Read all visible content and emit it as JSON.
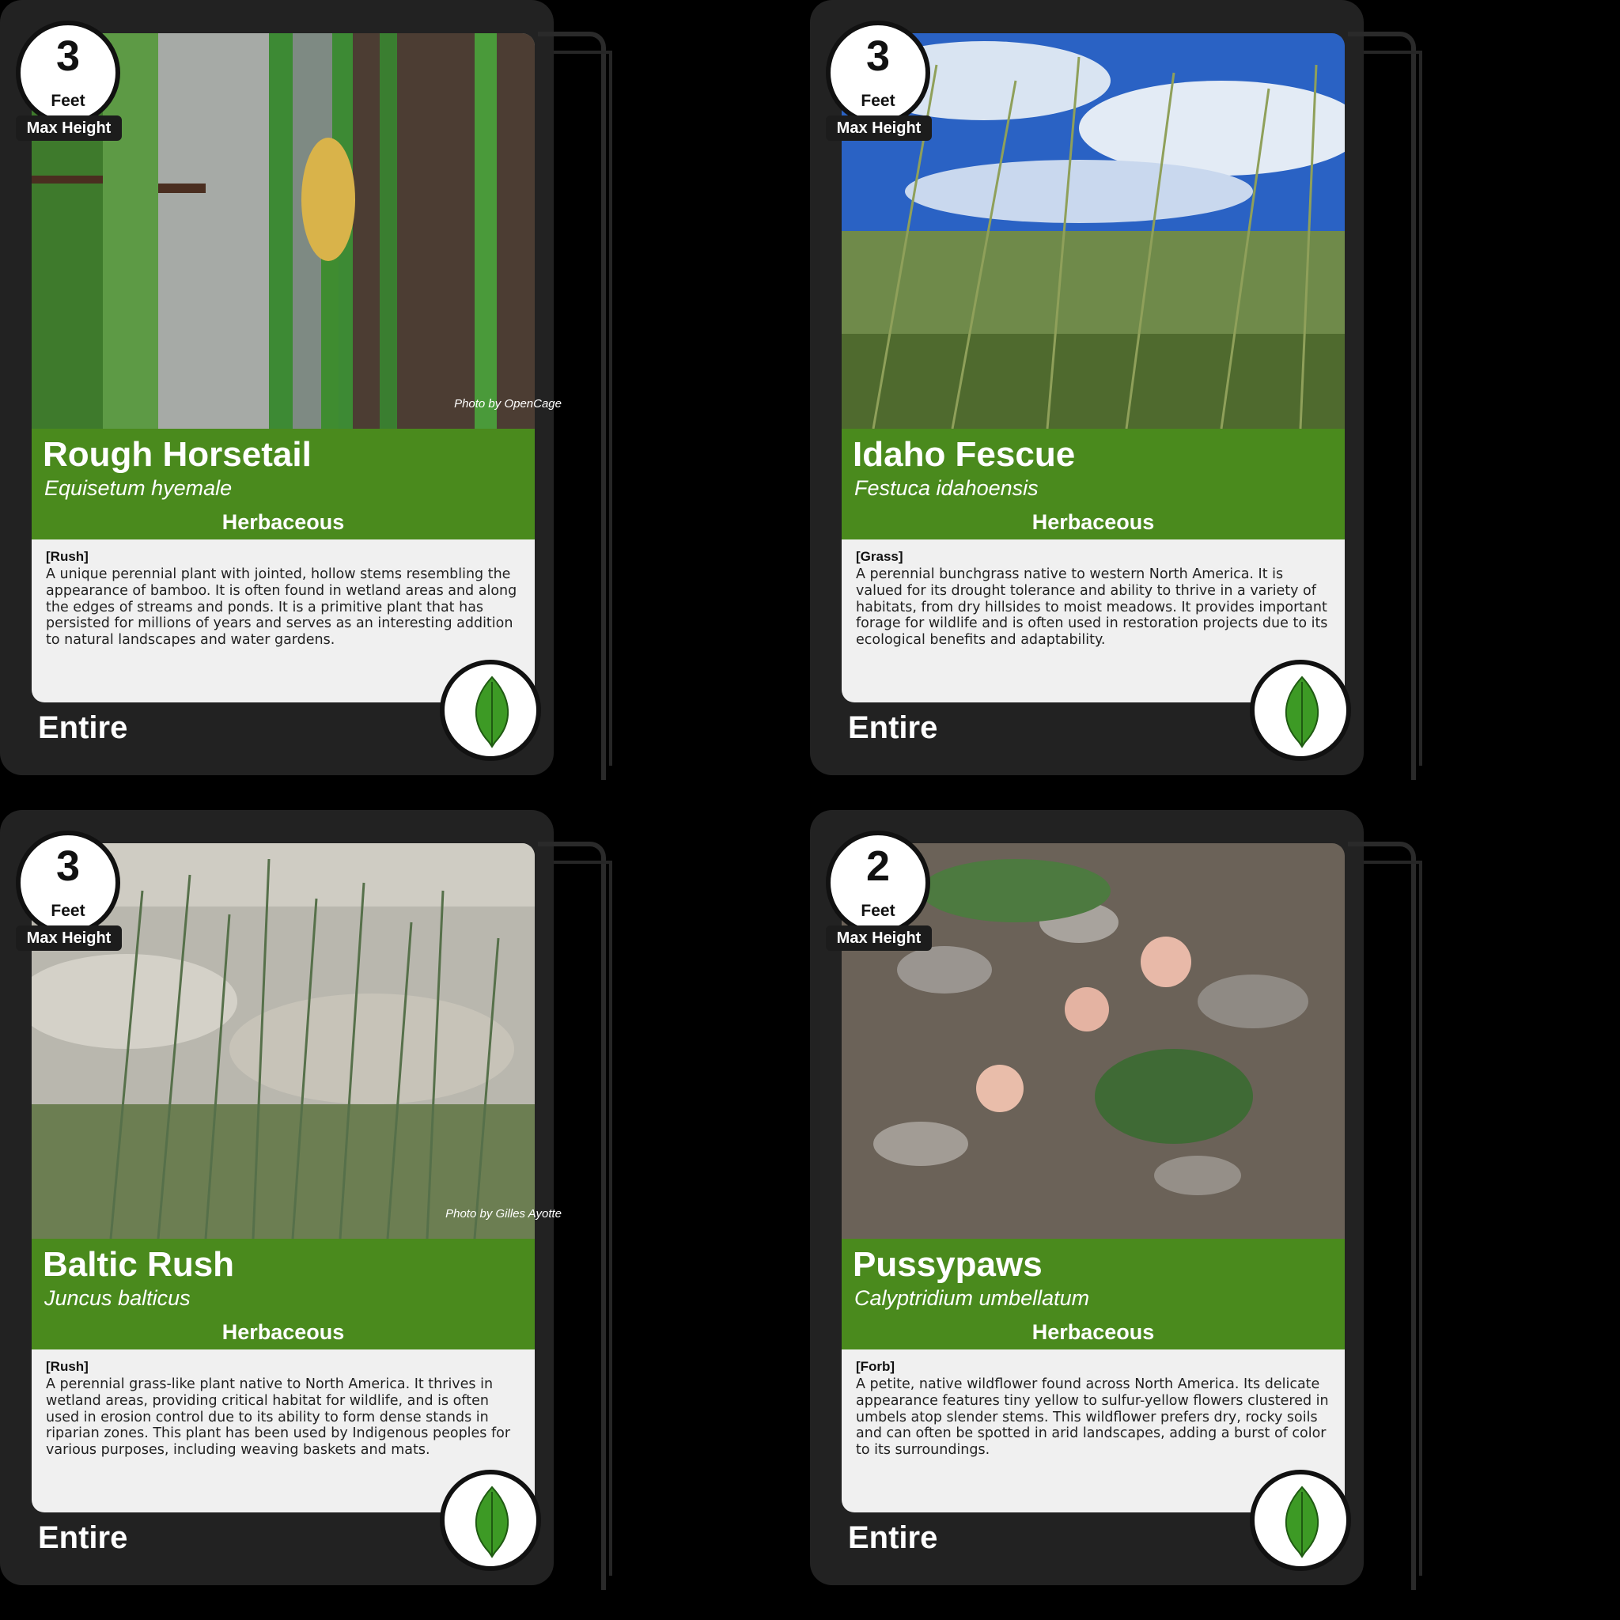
{
  "colors": {
    "accent_green": "#4a8a1d",
    "card_bg": "#222222",
    "desc_bg": "#f0f0f0"
  },
  "cards": [
    {
      "height_value": "3",
      "height_unit": "Feet",
      "height_label": "Max Height",
      "photo_credit": "Photo by OpenCage",
      "common_name": "Rough Horsetail",
      "scientific_name": "Equisetum hyemale",
      "habit": "Herbaceous",
      "category": "[Rush]",
      "description": "A unique perennial plant with jointed, hollow stems resembling the appearance of bamboo. It is often found in wetland areas and along the edges of streams and ponds. It is a primitive plant that has persisted for millions of years and serves as an interesting addition to natural landscapes and water gardens.",
      "leaf_margin": "Entire",
      "leaf_icon": "leaf-icon"
    },
    {
      "height_value": "3",
      "height_unit": "Feet",
      "height_label": "Max Height",
      "photo_credit": "",
      "common_name": "Idaho Fescue",
      "scientific_name": "Festuca idahoensis",
      "habit": "Herbaceous",
      "category": "[Grass]",
      "description": "A perennial bunchgrass native to western North America. It is valued for its drought tolerance and ability to thrive in a variety of habitats, from dry hillsides to moist meadows. It provides important forage for wildlife and is often used in restoration projects due to its ecological benefits and adaptability.",
      "leaf_margin": "Entire",
      "leaf_icon": "leaf-icon"
    },
    {
      "height_value": "3",
      "height_unit": "Feet",
      "height_label": "Max Height",
      "photo_credit": "Photo by Gilles Ayotte",
      "common_name": "Baltic Rush",
      "scientific_name": "Juncus balticus",
      "habit": "Herbaceous",
      "category": "[Rush]",
      "description": "A perennial grass-like plant native to North America. It thrives in wetland areas, providing critical habitat for wildlife, and is often used in erosion control due to its ability to form dense stands in riparian zones. This plant has been used by Indigenous peoples for various purposes, including weaving baskets and mats.",
      "leaf_margin": "Entire",
      "leaf_icon": "leaf-icon"
    },
    {
      "height_value": "2",
      "height_unit": "Feet",
      "height_label": "Max Height",
      "photo_credit": "",
      "common_name": "Pussypaws",
      "scientific_name": "Calyptridium umbellatum",
      "habit": "Herbaceous",
      "category": "[Forb]",
      "description": "A petite, native wildflower found across North America. Its delicate appearance features tiny yellow to sulfur-yellow flowers clustered in umbels atop slender stems. This wildflower prefers dry, rocky soils and can often be spotted in arid landscapes, adding a burst of color to its surroundings.",
      "leaf_margin": "Entire",
      "leaf_icon": "leaf-icon"
    }
  ]
}
